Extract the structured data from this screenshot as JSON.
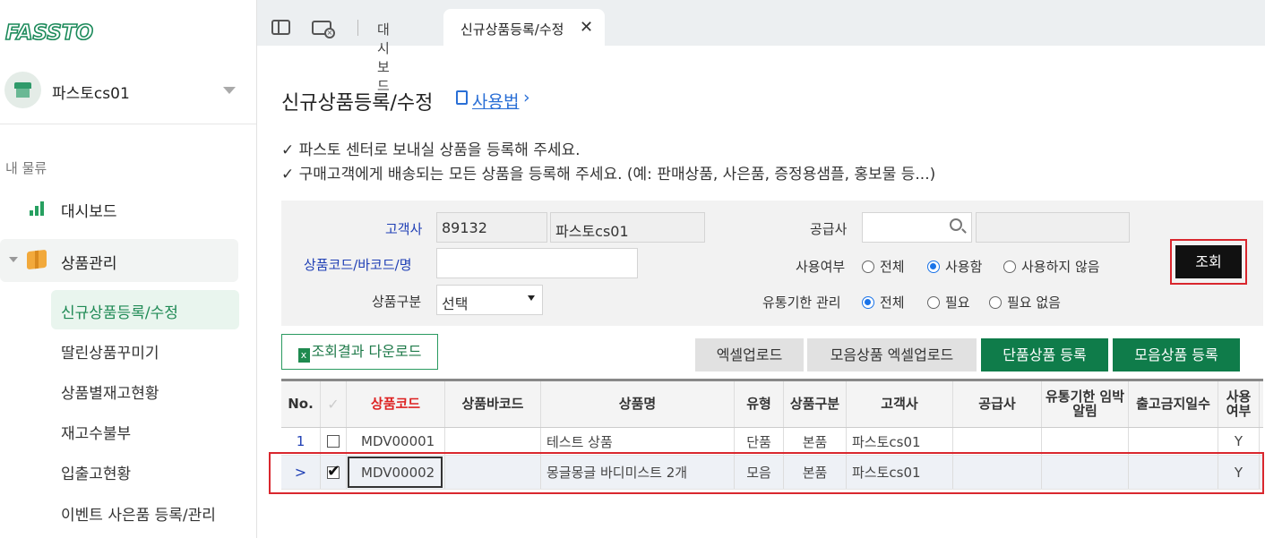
{
  "sidebar": {
    "logo": "FASSTO",
    "store_name": "파스토cs01",
    "section_label": "내 물류",
    "nav": {
      "dashboard": "대시보드",
      "product_mgmt": "상품관리"
    },
    "sub_items": [
      "신규상품등록/수정",
      "딸린상품꾸미기",
      "상품별재고현황",
      "재고수불부",
      "입출고현황",
      "이벤트 사은품 등록/관리"
    ]
  },
  "tabs": {
    "dashboard": "대시보드",
    "active": "신규상품등록/수정",
    "close": "✕"
  },
  "page": {
    "title": "신규상품등록/수정",
    "howto": "사용법",
    "notice1": "✓ 파스토 센터로 보내실 상품을 등록해 주세요.",
    "notice2": "✓ 구매고객에게 배송되는 모든 상품을 등록해 주세요. (예: 판매상품, 사은품, 증정용샘플, 홍보물 등...)"
  },
  "search": {
    "customer_label": "고객사",
    "customer_code": "89132",
    "customer_name": "파스토cs01",
    "code_label": "상품코드/바코드/명",
    "code_value": "",
    "category_label": "상품구분",
    "category_value": "선택",
    "supplier_label": "공급사",
    "use_label": "사용여부",
    "use_options": [
      "전체",
      "사용함",
      "사용하지 않음"
    ],
    "use_selected": "사용함",
    "expiry_label": "유통기한 관리",
    "expiry_options": [
      "전체",
      "필요",
      "필요 없음"
    ],
    "expiry_selected": "전체",
    "search_button": "조회"
  },
  "actions": {
    "download": "조회결과 다운로드",
    "excel_upload": "엑셀업로드",
    "bundle_excel_upload": "모음상품 엑셀업로드",
    "single_register": "단품상품 등록",
    "bundle_register": "모음상품 등록"
  },
  "table": {
    "headers": [
      "No.",
      "",
      "상품코드",
      "상품바코드",
      "상품명",
      "유형",
      "상품구분",
      "고객사",
      "공급사",
      "유통기한 임박 알림",
      "출고금지일수",
      "사용 여부"
    ],
    "rows": [
      {
        "no": "1",
        "checked": false,
        "code": "MDV00001",
        "barcode": "",
        "name": "테스트 상품",
        "type": "단품",
        "category": "본품",
        "customer": "파스토cs01",
        "supplier": "",
        "expiry_alert": "",
        "ship_block_days": "",
        "use": "Y"
      },
      {
        "no": ">",
        "checked": true,
        "code": "MDV00002",
        "barcode": "",
        "name": "몽글몽글 바디미스트 2개",
        "type": "모음",
        "category": "본품",
        "customer": "파스토cs01",
        "supplier": "",
        "expiry_alert": "",
        "ship_block_days": "",
        "use": "Y"
      }
    ]
  },
  "colors": {
    "brand_green": "#0f7c4a",
    "highlight_red": "#d9272e",
    "link_blue": "#1f3fb5"
  }
}
